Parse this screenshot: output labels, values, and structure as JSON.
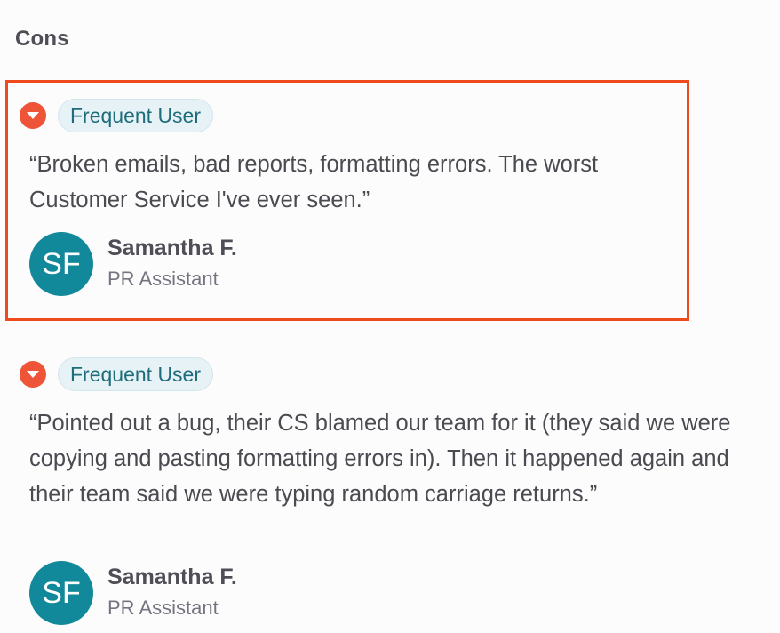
{
  "section": {
    "title": "Cons"
  },
  "reviews": [
    {
      "tag": "Frequent User",
      "quote": "“Broken emails, bad reports, formatting errors. The worst Customer Service I've ever seen.”",
      "author": {
        "initials": "SF",
        "name": "Samantha F.",
        "role": "PR Assistant"
      }
    },
    {
      "tag": "Frequent User",
      "quote": "“Pointed out a bug, their CS blamed our team for it (they said we were copying and pasting formatting errors in). Then it happened again and their team said we were typing random carriage returns.”",
      "author": {
        "initials": "SF",
        "name": "Samantha F.",
        "role": "PR Assistant"
      }
    }
  ],
  "colors": {
    "highlight_border": "#ef4a1e",
    "negative_icon": "#ee5437",
    "badge_bg": "#e6f2f6",
    "badge_text": "#1e6d7a",
    "avatar_bg": "#12899a"
  },
  "icons": {
    "negative": "chevron-down-circle-icon"
  }
}
